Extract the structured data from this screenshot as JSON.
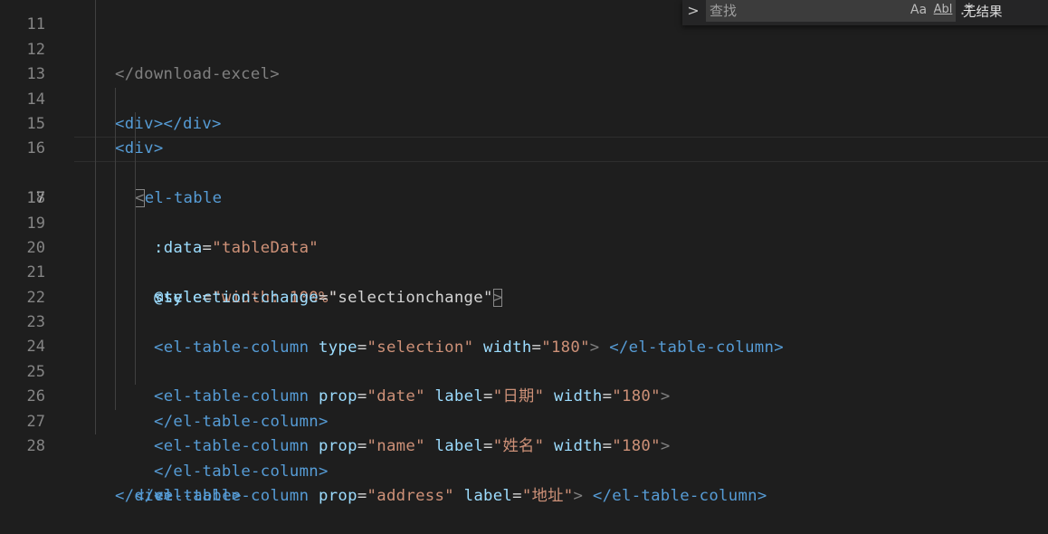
{
  "editor": {
    "current_line": "17",
    "lines": [
      {
        "num": "11",
        "c1": "</download-excel>"
      },
      {
        "num": "12"
      },
      {
        "num": "13",
        "c1": "<div>",
        "c2": "</div>"
      },
      {
        "num": "14",
        "c1": "<div>"
      },
      {
        "num": "15",
        "c1": "<",
        "c2": "el-table"
      },
      {
        "num": "16",
        "c1": ":data",
        "c2": "=",
        "c3": "\"tableData\""
      },
      {
        "num": "17",
        "c1": "style",
        "c2": "=",
        "c3": "\"width: 100%\""
      },
      {
        "num": "18",
        "c1": "@selection-change",
        "c2": "=",
        "c3": "\"selectionchange\"",
        "c4": ">"
      },
      {
        "num": "19"
      },
      {
        "num": "20",
        "c1": "<el-table-column",
        "c2": "type",
        "c3": "=",
        "c4": "\"selection\"",
        "c5": "width",
        "c6": "=",
        "c7": "\"180\"",
        "c8": ">",
        "c9": "</el-table-column>"
      },
      {
        "num": "21"
      },
      {
        "num": "22",
        "c1": "<el-table-column",
        "c2": "prop",
        "c3": "=",
        "c4": "\"date\"",
        "c5": "label",
        "c6": "=",
        "c7": "\"日期\"",
        "c8": "width",
        "c9": "=",
        "c10": "\"180\"",
        "c11": ">"
      },
      {
        "num": "23",
        "c1": "</el-table-column>"
      },
      {
        "num": "24",
        "c1": "<el-table-column",
        "c2": "prop",
        "c3": "=",
        "c4": "\"name\"",
        "c5": "label",
        "c6": "=",
        "c7": "\"姓名\"",
        "c8": "width",
        "c9": "=",
        "c10": "\"180\"",
        "c11": ">"
      },
      {
        "num": "25",
        "c1": "</el-table-column>"
      },
      {
        "num": "26",
        "c1": "<el-table-column",
        "c2": "prop",
        "c3": "=",
        "c4": "\"address\"",
        "c5": "label",
        "c6": "=",
        "c7": "\"地址\"",
        "c8": ">",
        "c9": "</el-table-column>"
      },
      {
        "num": "27",
        "c1": "</el-table>"
      },
      {
        "num": "28",
        "c1": "</div>"
      }
    ]
  },
  "find_widget": {
    "toggle_icon": "chevron-right-icon",
    "toggle_glyph": ">",
    "placeholder": "查找",
    "match_case_label": "Aa",
    "whole_word_label": "Abl",
    "regex_label": ".*",
    "result_text": "无结果"
  },
  "colors": {
    "background": "#1e1e1e",
    "tag": "#569cd6",
    "attribute": "#9cdcfe",
    "string": "#ce9178",
    "punctuation": "#808080",
    "line_number": "#858585"
  }
}
